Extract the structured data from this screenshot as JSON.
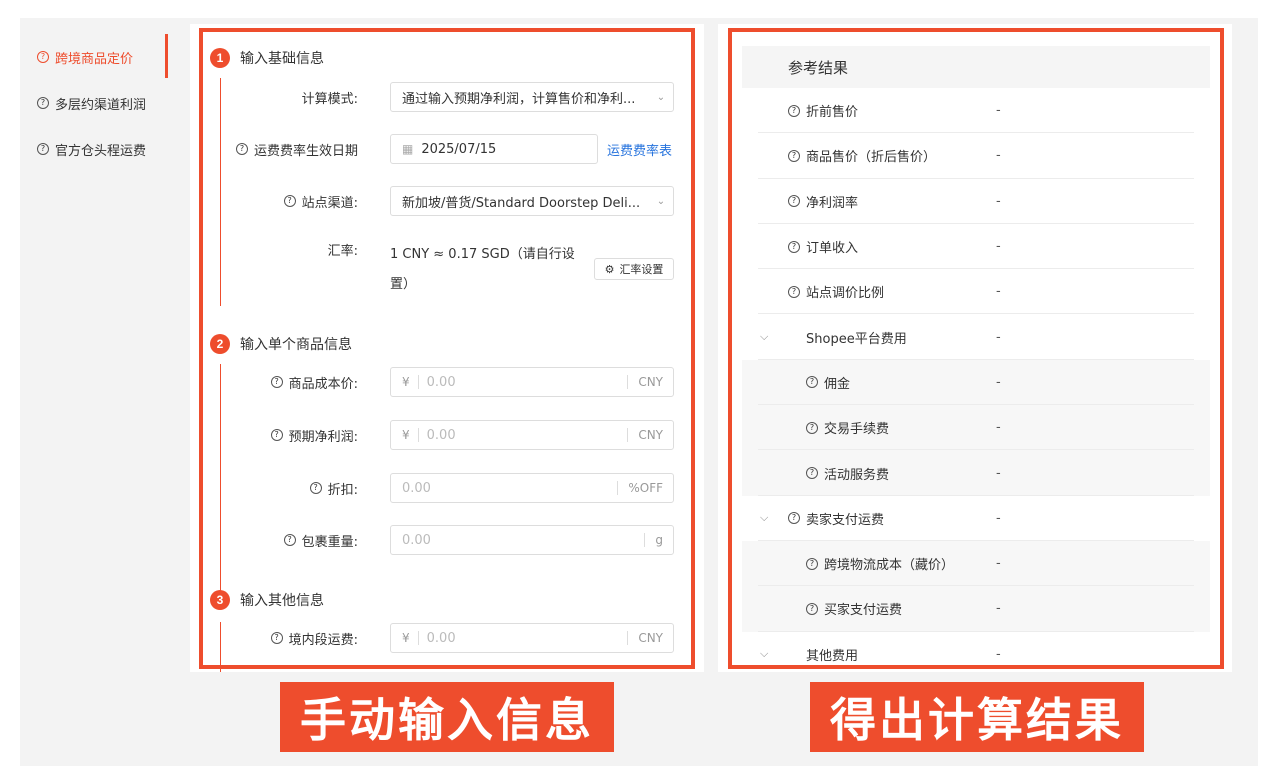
{
  "nav": {
    "items": [
      {
        "label": "跨境商品定价",
        "active": true
      },
      {
        "label": "多层约渠道利润",
        "active": false
      },
      {
        "label": "官方仓头程运费",
        "active": false
      }
    ]
  },
  "form": {
    "step1": {
      "num": "1",
      "title": "输入基础信息"
    },
    "calc_mode_label": "计算模式:",
    "calc_mode_value": "通过输入预期净利润，计算售价和净利...",
    "date_label": "运费费率生效日期",
    "date_value": "2025/07/15",
    "rate_table_link": "运费费率表",
    "channel_label": "站点渠道:",
    "channel_value": "新加坡/普货/Standard Doorstep Deli...",
    "exchange_label": "汇率:",
    "exchange_line1": "1 CNY ≈ 0.17 SGD（请自行设",
    "exchange_line2": "置）",
    "exchange_button": "汇率设置",
    "step2": {
      "num": "2",
      "title": "输入单个商品信息"
    },
    "cost_label": "商品成本价:",
    "cost_prefix": "¥",
    "cost_placeholder": "0.00",
    "cost_suffix": "CNY",
    "profit_label": "预期净利润:",
    "profit_prefix": "¥",
    "profit_placeholder": "0.00",
    "profit_suffix": "CNY",
    "discount_label": "折扣:",
    "discount_placeholder": "0.00",
    "discount_suffix": "%OFF",
    "weight_label": "包裹重量:",
    "weight_placeholder": "0.00",
    "weight_suffix": "g",
    "step3": {
      "num": "3",
      "title": "输入其他信息"
    },
    "domestic_label": "境内段运费:",
    "domestic_prefix": "¥",
    "domestic_placeholder": "0.00",
    "domestic_suffix": "CNY"
  },
  "results": {
    "title": "参考结果",
    "rows": [
      {
        "label": "折前售价",
        "value": "-",
        "help": true,
        "indent": false,
        "sub": false,
        "arrow": false
      },
      {
        "label": "商品售价（折后售价）",
        "value": "-",
        "help": true,
        "indent": false,
        "sub": false,
        "arrow": false
      },
      {
        "label": "净利润率",
        "value": "-",
        "help": true,
        "indent": false,
        "sub": false,
        "arrow": false
      },
      {
        "label": "订单收入",
        "value": "-",
        "help": true,
        "indent": false,
        "sub": false,
        "arrow": false
      },
      {
        "label": "站点调价比例",
        "value": "-",
        "help": true,
        "indent": false,
        "sub": false,
        "arrow": false
      },
      {
        "label": "Shopee平台费用",
        "value": "-",
        "help": false,
        "indent": true,
        "sub": false,
        "arrow": true
      },
      {
        "label": "佣金",
        "value": "-",
        "help": true,
        "indent": true,
        "sub": true,
        "arrow": false
      },
      {
        "label": "交易手续费",
        "value": "-",
        "help": true,
        "indent": true,
        "sub": true,
        "arrow": false
      },
      {
        "label": "活动服务费",
        "value": "-",
        "help": true,
        "indent": true,
        "sub": true,
        "arrow": false
      },
      {
        "label": "卖家支付运费",
        "value": "-",
        "help": true,
        "indent": false,
        "sub": false,
        "arrow": true
      },
      {
        "label": "跨境物流成本（藏价）",
        "value": "-",
        "help": true,
        "indent": true,
        "sub": true,
        "arrow": false
      },
      {
        "label": "买家支付运费",
        "value": "-",
        "help": true,
        "indent": true,
        "sub": true,
        "arrow": false
      },
      {
        "label": "其他费用",
        "value": "-",
        "help": false,
        "indent": true,
        "sub": false,
        "arrow": true
      }
    ]
  },
  "captions": {
    "left": "手动输入信息",
    "right": "得出计算结果"
  },
  "colors": {
    "accent": "#ee4d2d",
    "link": "#2673dd"
  }
}
